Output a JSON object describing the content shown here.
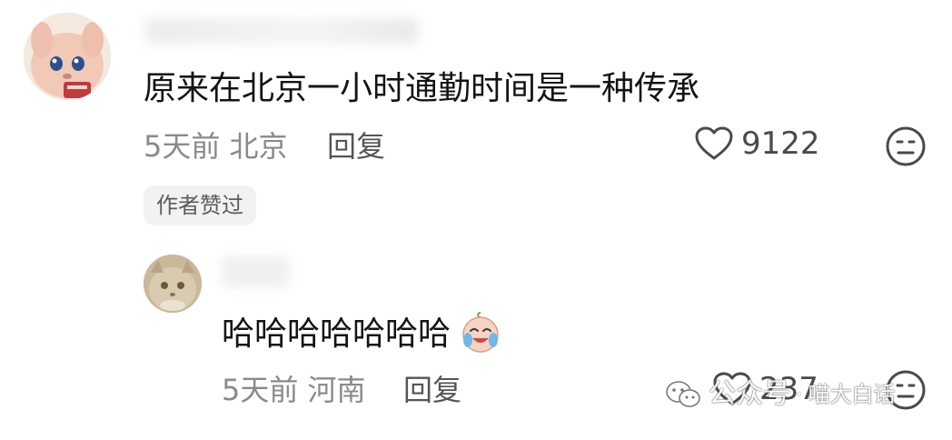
{
  "comments": [
    {
      "text": "原来在北京一小时通勤时间是一种传承",
      "time": "5天前",
      "location": "北京",
      "reply_label": "回复",
      "likes": "9122",
      "author_badge": "作者赞过"
    }
  ],
  "reply": {
    "text": "哈哈哈哈哈哈哈",
    "time": "5天前",
    "location": "河南",
    "reply_label": "回复",
    "likes": "237"
  },
  "watermark": {
    "label": "公众号",
    "separator": "·",
    "name": "喵大白话"
  },
  "icons": {
    "like": "heart-outline-icon",
    "dislike": "frown-face-icon",
    "emoji": "crying-laughing-emoji-icon",
    "watermark": "wechat-icon"
  },
  "colors": {
    "meta_text": "#8a8a8a",
    "body_text": "#141414",
    "badge_bg": "#f2f2f2"
  }
}
